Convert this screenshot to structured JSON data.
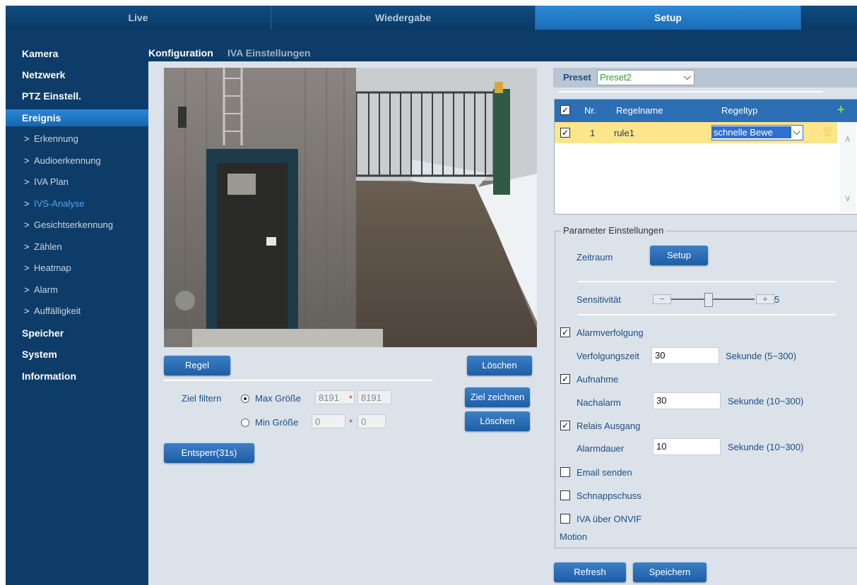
{
  "nav": {
    "tabs": [
      {
        "label": "Live"
      },
      {
        "label": "Wiedergabe"
      },
      {
        "label": "Setup"
      }
    ]
  },
  "sidebar": {
    "items": [
      {
        "label": "Kamera"
      },
      {
        "label": "Netzwerk"
      },
      {
        "label": "PTZ Einstell."
      },
      {
        "label": "Ereignis"
      },
      {
        "label": "Erkennung"
      },
      {
        "label": "Audioerkennung"
      },
      {
        "label": "IVA Plan"
      },
      {
        "label": "IVS-Analyse"
      },
      {
        "label": "Gesichtserkennung"
      },
      {
        "label": "Zählen"
      },
      {
        "label": "Heatmap"
      },
      {
        "label": "Alarm"
      },
      {
        "label": "Auffälligkeit"
      },
      {
        "label": "Speicher"
      },
      {
        "label": "System"
      },
      {
        "label": "Information"
      }
    ]
  },
  "subtabs": {
    "config": "Konfiguration",
    "iva": "IVA Einstellungen"
  },
  "left": {
    "rule_button": "Regel",
    "delete_button": "Löschen",
    "filter_label": "Ziel filtern",
    "max_label": "Max Größe",
    "max_w": "8191",
    "max_h": "8191",
    "min_label": "Min Größe",
    "min_w": "0",
    "min_h": "0",
    "times": "*",
    "draw_target_button": "Ziel zeichnen",
    "delete_button2": "Löschen",
    "unlock_button": "Entsperr(31s)"
  },
  "preset": {
    "label": "Preset",
    "value": "Preset2"
  },
  "rules_table": {
    "headers": {
      "nr": "Nr.",
      "name": "Regelname",
      "type": "Regeltyp"
    },
    "rows": [
      {
        "nr": "1",
        "name": "rule1",
        "type": "schnelle Bewe"
      }
    ]
  },
  "params": {
    "legend": "Parameter Einstellungen",
    "zeitraum": "Zeitraum",
    "setup_button": "Setup",
    "sens_label": "Sensitivität",
    "sens_value": "5",
    "sens_level": 0.44,
    "alarmverfolgung": "Alarmverfolgung",
    "verfolgungszeit": "Verfolgungszeit",
    "verfolgungszeit_value": "30",
    "verfolgungszeit_unit": "Sekunde (5~300)",
    "aufnahme": "Aufnahme",
    "nachalarm": "Nachalarm",
    "nachalarm_value": "30",
    "nachalarm_unit": "Sekunde (10~300)",
    "relais": "Relais Ausgang",
    "alarmdauer": "Alarmdauer",
    "alarmdauer_value": "10",
    "alarmdauer_unit": "Sekunde (10~300)",
    "email": "Email senden",
    "snapshot": "Schnappschuss",
    "onvif": "IVA über ONVIF",
    "motion": "Motion"
  },
  "footer": {
    "refresh": "Refresh",
    "save": "Speichern"
  },
  "colors": {
    "nav_bg": "#0e3c68",
    "active_blue": "#2b86d6",
    "content_bg": "#dbe2ea",
    "row_highlight": "#fde58a"
  }
}
